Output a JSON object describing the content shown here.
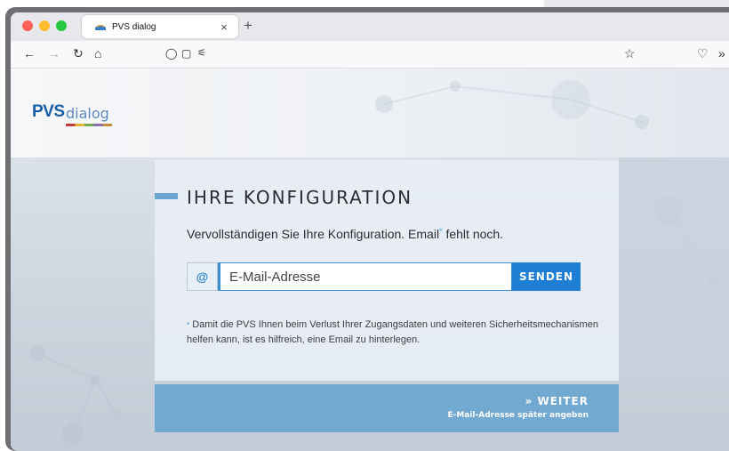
{
  "browser": {
    "tab_title": "PVS dialog",
    "tab_close": "×",
    "new_tab": "+",
    "nav": {
      "back": "←",
      "forward": "→",
      "reload": "↻",
      "home": "⌂",
      "shield": "◯",
      "page": "▢",
      "permissions": "⚟",
      "bookmark": "☆",
      "pocket": "♡",
      "overflow": "»"
    }
  },
  "logo": {
    "primary": "PVS",
    "secondary": "dialog"
  },
  "config": {
    "title": "IHRE KONFIGURATION",
    "subtitle_before": "Vervollständigen Sie Ihre Konfiguration. Email",
    "subtitle_after": " fehlt noch.",
    "asterisk": "*",
    "at_symbol": "@",
    "email_placeholder": "E-Mail-Adresse",
    "send_label": "SENDEN",
    "note": "Damit die PVS Ihnen beim Verlust Ihrer Zugangsdaten und weiteren Sicherheitsmechanismen helfen kann, ist es hilfreich, eine Email zu hinterlegen."
  },
  "footer": {
    "weiter": "» WEITER",
    "later": "E-Mail-Adresse später angeben"
  },
  "colors": {
    "accent": "#1e7ed3",
    "footer_bar": "#72a9d1",
    "logo_blue": "#1a5ea8"
  }
}
